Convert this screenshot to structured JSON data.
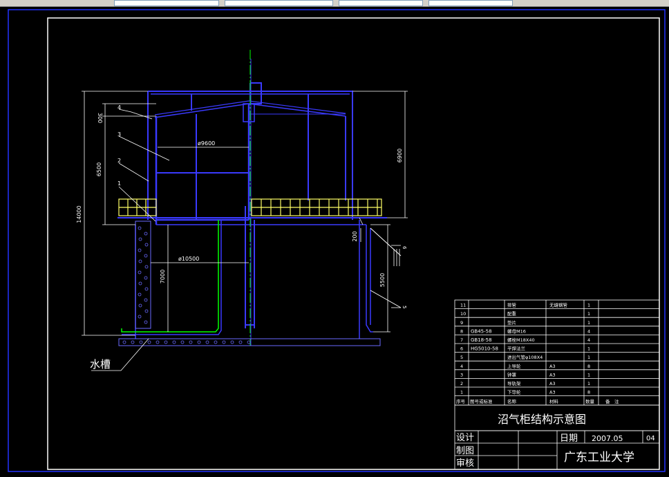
{
  "title_block": {
    "drawing_title": "沼气柜结构示意图",
    "design": "设计",
    "drafting": "制图",
    "review": "审核",
    "date_label": "日期",
    "date_value": "2007.05",
    "sheet": "04",
    "school": "广东工业大学"
  },
  "dimensions": {
    "d1": "300",
    "d2": "6500",
    "d3": "14000",
    "d4": "7000",
    "d5": "6900",
    "d6": "200",
    "d7": "5500",
    "dia1": "ø9600",
    "dia2": "ø10500"
  },
  "callouts": {
    "c1": "1",
    "c2": "2",
    "c3": "3",
    "c4": "4",
    "c5": "5",
    "c6": "6",
    "water_tank": "水槽"
  },
  "bom": {
    "rows": [
      {
        "no": "11",
        "code": "",
        "name": "排管",
        "material": "无缝钢管",
        "qty": "1",
        "note": ""
      },
      {
        "no": "10",
        "code": "",
        "name": "配重",
        "material": "",
        "qty": "1",
        "note": ""
      },
      {
        "no": "9",
        "code": "",
        "name": "垫片",
        "material": "",
        "qty": "1",
        "note": ""
      },
      {
        "no": "8",
        "code": "GB45-58",
        "name": "螺母M16",
        "material": "",
        "qty": "4",
        "note": ""
      },
      {
        "no": "7",
        "code": "GB18-58",
        "name": "螺栓M18X40",
        "material": "",
        "qty": "4",
        "note": ""
      },
      {
        "no": "6",
        "code": "HG5010-58",
        "name": "平焊法兰",
        "material": "",
        "qty": "1",
        "note": ""
      },
      {
        "no": "5",
        "code": "",
        "name": "进出气管φ108X4",
        "material": "",
        "qty": "1",
        "note": ""
      },
      {
        "no": "4",
        "code": "",
        "name": "上导轮",
        "material": "A3",
        "qty": "8",
        "note": ""
      },
      {
        "no": "3",
        "code": "",
        "name": "钟罩",
        "material": "A3",
        "qty": "1",
        "note": ""
      },
      {
        "no": "2",
        "code": "",
        "name": "导轨架",
        "material": "A3",
        "qty": "1",
        "note": ""
      },
      {
        "no": "1",
        "code": "",
        "name": "下导轮",
        "material": "A3",
        "qty": "8",
        "note": ""
      }
    ],
    "header": {
      "no": "序号",
      "code": "图号或标准",
      "name": "名称",
      "material": "材料",
      "qty": "数量",
      "note": "备　注"
    }
  },
  "colors": {
    "background": "#000000",
    "frame": "#1f2fff",
    "structure": "#3b3bff",
    "dimension": "#ffffff",
    "center_line": "#00ff00",
    "railing": "#ffff66",
    "pipe": "#00ff00",
    "masonry": "#6a6aff"
  }
}
